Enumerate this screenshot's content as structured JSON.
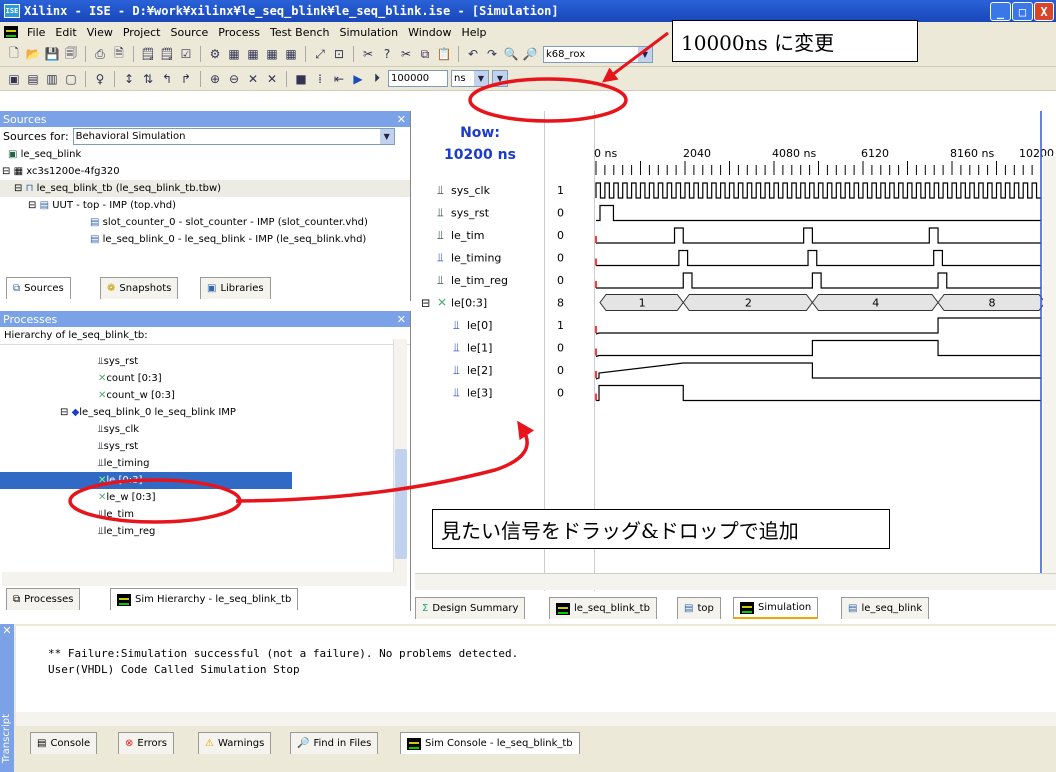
{
  "window": {
    "title": "Xilinx - ISE - D:¥work¥xilinx¥le_seq_blink¥le_seq_blink.ise - [Simulation]",
    "app_icon_label": "ISE",
    "minimize": "_",
    "maximize": "□",
    "close": "X"
  },
  "menu": [
    "File",
    "Edit",
    "View",
    "Project",
    "Source",
    "Process",
    "Test Bench",
    "Simulation",
    "Window",
    "Help"
  ],
  "toolbar": {
    "search_value": "k68_rox",
    "sim_time_value": "100000",
    "sim_unit_value": "ns"
  },
  "sources_panel": {
    "title": "Sources",
    "sources_for_label": "Sources for:",
    "sources_for_value": "Behavioral Simulation",
    "tree": [
      "le_seq_blink",
      "xc3s1200e-4fg320",
      "le_seq_blink_tb (le_seq_blink_tb.tbw)",
      "UUT - top - IMP (top.vhd)",
      "slot_counter_0 - slot_counter - IMP (slot_counter.vhd)",
      "le_seq_blink_0 - le_seq_blink - IMP (le_seq_blink.vhd)"
    ],
    "tabs": [
      "Sources",
      "Snapshots",
      "Libraries"
    ]
  },
  "processes_panel": {
    "title": "Processes",
    "hierarchy_label": "Hierarchy of le_seq_blink_tb:",
    "tree": [
      "sys_rst",
      "count [0:3]",
      "count_w [0:3]",
      "le_seq_blink_0 le_seq_blink IMP",
      "sys_clk",
      "sys_rst",
      "le_timing",
      "le [0:3]",
      "le_w [0:3]",
      "le_tim",
      "le_tim_reg"
    ],
    "tabs": [
      "Processes",
      "Sim Hierarchy - le_seq_blink_tb"
    ]
  },
  "waveform": {
    "now_label": "Now:",
    "now_value": "10200 ns",
    "ruler": [
      "0 ns",
      "2040",
      "4080 ns",
      "6120",
      "8160 ns",
      "10200"
    ],
    "signals": [
      {
        "name": "sys_clk",
        "value": "1"
      },
      {
        "name": "sys_rst",
        "value": "0"
      },
      {
        "name": "le_tim",
        "value": "0"
      },
      {
        "name": "le_timing",
        "value": "0"
      },
      {
        "name": "le_tim_reg",
        "value": "0"
      },
      {
        "name": "le[0:3]",
        "value": "8"
      },
      {
        "name": "le[0]",
        "value": "1"
      },
      {
        "name": "le[1]",
        "value": "0"
      },
      {
        "name": "le[2]",
        "value": "0"
      },
      {
        "name": "le[3]",
        "value": "0"
      }
    ],
    "bus_values": [
      "1",
      "2",
      "4",
      "8"
    ]
  },
  "doc_tabs": [
    "Design Summary",
    "le_seq_blink_tb",
    "top",
    "Simulation",
    "le_seq_blink"
  ],
  "console": {
    "line1": "** Failure:Simulation successful (not a failure).  No problems detected.",
    "line2": "User(VHDL) Code Called Simulation Stop",
    "side_label": "Transcript",
    "tabs": [
      "Console",
      "Errors",
      "Warnings",
      "Find in Files",
      "Sim Console - le_seq_blink_tb"
    ]
  },
  "annotations": {
    "time_change": "10000ns に変更",
    "drag_drop": "見たい信号をドラッグ&ドロップで追加"
  },
  "colors": {
    "title_blue": "#1f55c8",
    "panel_header": "#7ba2e7",
    "wave_green": "#000000",
    "selection": "#316ac5",
    "callout_red": "#e8141c"
  }
}
